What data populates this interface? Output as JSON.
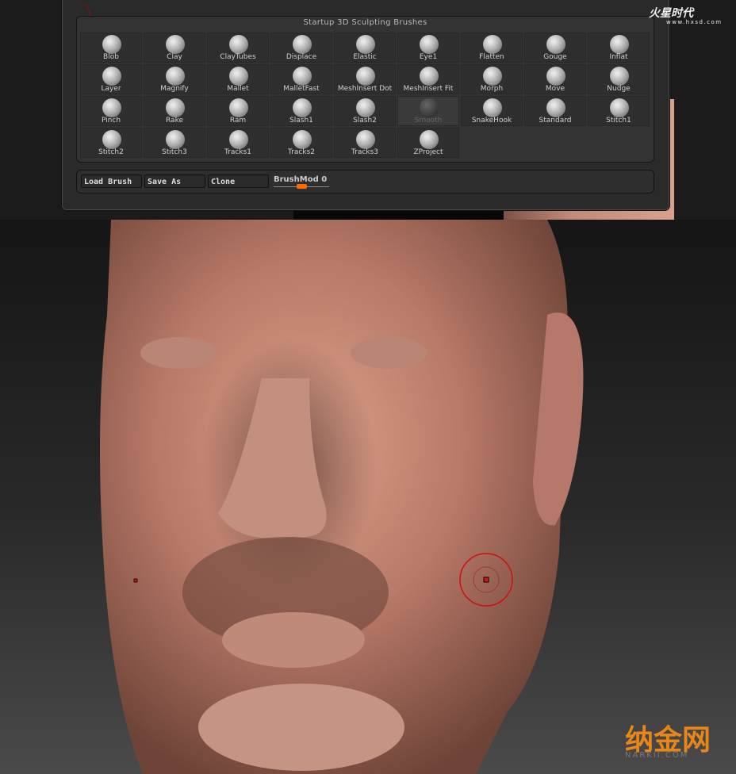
{
  "palette": {
    "title": "Startup 3D Sculpting Brushes",
    "selected": "Smooth",
    "brushes": [
      "Blob",
      "Clay",
      "ClayTubes",
      "Displace",
      "Elastic",
      "Eye1",
      "Flatten",
      "Gouge",
      "Inflat",
      "Layer",
      "Magnify",
      "Mallet",
      "MalletFast",
      "MeshInsert Dot",
      "MeshInsert Fit",
      "Morph",
      "Move",
      "Nudge",
      "Pinch",
      "Rake",
      "Ram",
      "Slash1",
      "Slash2",
      "Smooth",
      "SnakeHook",
      "Standard",
      "Stitch1",
      "Stitch2",
      "Stitch3",
      "Tracks1",
      "Tracks2",
      "Tracks3",
      "ZProject"
    ]
  },
  "toolbar": {
    "load_brush": "Load Brush",
    "save_as": "Save As",
    "clone": "Clone",
    "brushmod_label": "BrushMod",
    "brushmod_value": "0",
    "slider_accent": "#ff6a00"
  },
  "watermarks": {
    "top_cn": "火星时代",
    "top_url": "www.hxsd.com",
    "bottom_cn": "纳金网",
    "bottom_url": "NARKII.COM"
  },
  "cursor": {
    "color": "#d01010"
  }
}
